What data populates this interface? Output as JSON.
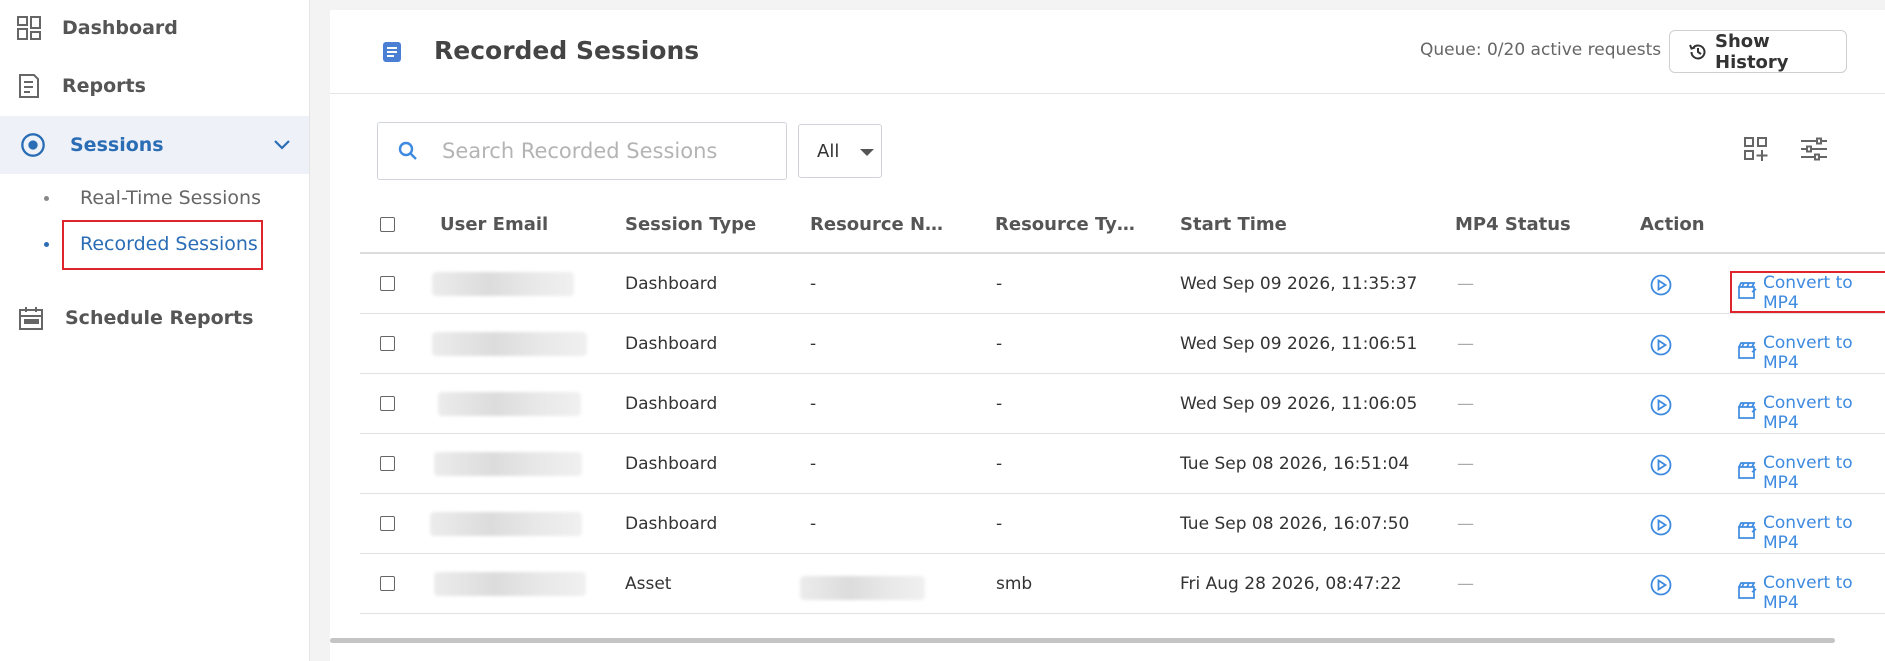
{
  "sidebar": {
    "items": [
      {
        "label": "Dashboard",
        "icon": "dashboard-icon"
      },
      {
        "label": "Reports",
        "icon": "reports-icon"
      },
      {
        "label": "Sessions",
        "icon": "sessions-icon",
        "active": true
      },
      {
        "label": "Schedule Reports",
        "icon": "calendar-icon"
      }
    ],
    "sub_items": [
      {
        "label": "Real-Time Sessions"
      },
      {
        "label": "Recorded Sessions",
        "active": true
      }
    ]
  },
  "header": {
    "title": "Recorded Sessions",
    "queue": "Queue: 0/20 active requests",
    "history_label": "Show History"
  },
  "toolbar": {
    "search_placeholder": "Search Recorded Sessions",
    "filter_value": "All"
  },
  "table": {
    "columns": [
      "User Email",
      "Session Type",
      "Resource N…",
      "Resource Ty…",
      "Start Time",
      "MP4 Status",
      "Action"
    ],
    "rows": [
      {
        "session_type": "Dashboard",
        "resource_name": "-",
        "resource_type": "-",
        "start_time": "Wed Sep 09 2026, 11:35:37",
        "mp4_status": "—",
        "action": "Convert to MP4"
      },
      {
        "session_type": "Dashboard",
        "resource_name": "-",
        "resource_type": "-",
        "start_time": "Wed Sep 09 2026, 11:06:51",
        "mp4_status": "—",
        "action": "Convert to MP4"
      },
      {
        "session_type": "Dashboard",
        "resource_name": "-",
        "resource_type": "-",
        "start_time": "Wed Sep 09 2026, 11:06:05",
        "mp4_status": "—",
        "action": "Convert to MP4"
      },
      {
        "session_type": "Dashboard",
        "resource_name": "-",
        "resource_type": "-",
        "start_time": "Tue Sep 08 2026, 16:51:04",
        "mp4_status": "—",
        "action": "Convert to MP4"
      },
      {
        "session_type": "Dashboard",
        "resource_name": "-",
        "resource_type": "-",
        "start_time": "Tue Sep 08 2026, 16:07:50",
        "mp4_status": "—",
        "action": "Convert to MP4"
      },
      {
        "session_type": "Asset",
        "resource_name": "",
        "resource_type": "smb",
        "start_time": "Fri Aug 28 2026, 08:47:22",
        "mp4_status": "—",
        "action": "Convert to MP4"
      }
    ]
  },
  "colors": {
    "accent": "#2a6db5",
    "link": "#3d8ae0",
    "highlight": "#e0242b"
  }
}
